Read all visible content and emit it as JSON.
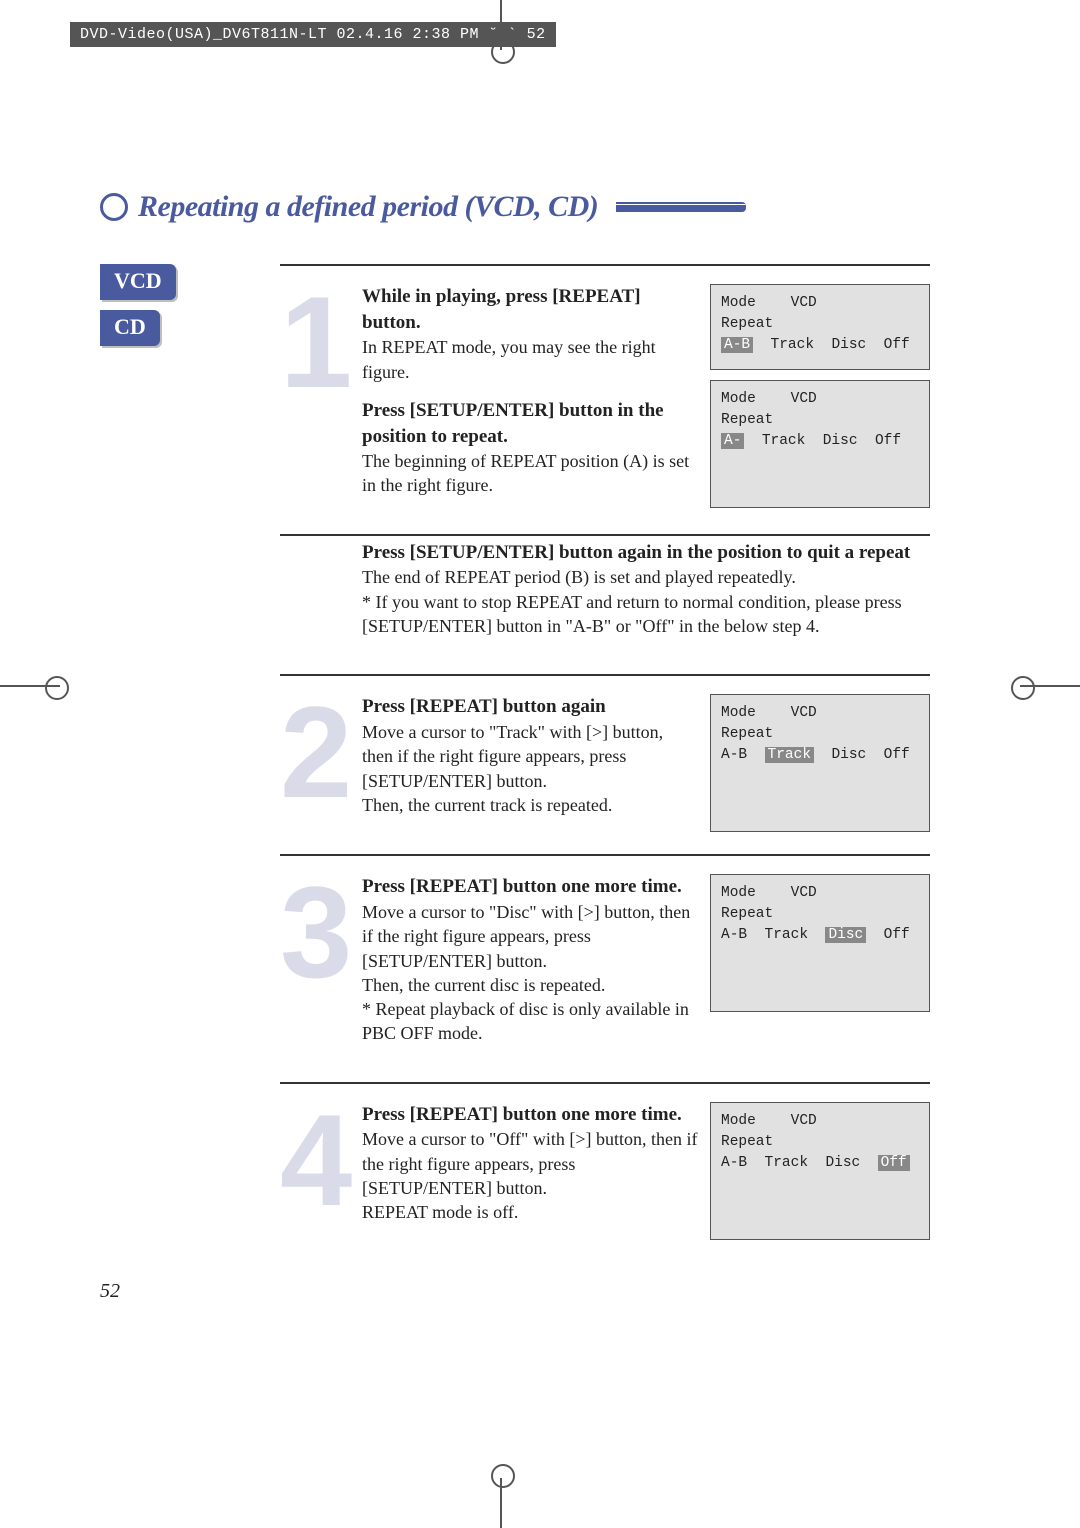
{
  "header_strip": "DVD-Video(USA)_DV6T811N-LT  02.4.16 2:38 PM  ˘   `  52",
  "title": "Repeating a defined period (VCD, CD)",
  "badges": {
    "vcd": "VCD",
    "cd": "CD"
  },
  "steps": [
    {
      "num": "1",
      "blocks": [
        {
          "heading": "While in playing, press [REPEAT] button.",
          "body": "In REPEAT mode, you may see the right figure."
        },
        {
          "heading": "Press [SETUP/ENTER] button in the position to repeat.",
          "body": "The beginning of REPEAT position (A) is set in the right figure."
        },
        {
          "heading": "Press [SETUP/ENTER] button again in the position to quit a repeat",
          "body": "The end of REPEAT period (B) is set and played repeatedly.",
          "note": "* If you want to stop REPEAT and return to normal condition, please press [SETUP/ENTER] button in  \"A-B\" or  \"Off\" in the below step 4."
        }
      ],
      "osd": [
        {
          "mode": "VCD",
          "repeat": "Repeat",
          "opts": [
            "A-B",
            "Track",
            "Disc",
            "Off"
          ],
          "hl": 0
        },
        {
          "mode": "VCD",
          "repeat": "Repeat",
          "opts": [
            "A-",
            "Track",
            "Disc",
            "Off"
          ],
          "hl": 0,
          "tall": true
        }
      ]
    },
    {
      "num": "2",
      "blocks": [
        {
          "heading": "Press [REPEAT] button again",
          "body": "Move a cursor to \"Track\" with [>] button, then if the right figure appears, press [SETUP/ENTER] button.",
          "body2": "Then, the current track is repeated."
        }
      ],
      "osd": [
        {
          "mode": "VCD",
          "repeat": "Repeat",
          "opts": [
            "A-B",
            "Track",
            "Disc",
            "Off"
          ],
          "hl": 1,
          "tall": true
        }
      ]
    },
    {
      "num": "3",
      "blocks": [
        {
          "heading": "Press [REPEAT] button one more time.",
          "body": "Move a cursor to \"Disc\" with [>] button, then if the right figure appears, press [SETUP/ENTER] button.",
          "body2": "Then, the current disc is repeated.",
          "note": "* Repeat playback of disc is only available in PBC OFF mode."
        }
      ],
      "osd": [
        {
          "mode": "VCD",
          "repeat": "Repeat",
          "opts": [
            "A-B",
            "Track",
            "Disc",
            "Off"
          ],
          "hl": 2,
          "tall": true
        }
      ]
    },
    {
      "num": "4",
      "blocks": [
        {
          "heading": "Press [REPEAT] button one more time.",
          "body": "Move a cursor to \"Off\" with [>] button, then if the right figure appears, press [SETUP/ENTER] button.",
          "body2": "REPEAT mode is off."
        }
      ],
      "osd": [
        {
          "mode": "VCD",
          "repeat": "Repeat",
          "opts": [
            "A-B",
            "Track",
            "Disc",
            "Off"
          ],
          "hl": 3,
          "tall": true
        }
      ]
    }
  ],
  "osd_labels": {
    "mode": "Mode"
  },
  "page_number": "52"
}
